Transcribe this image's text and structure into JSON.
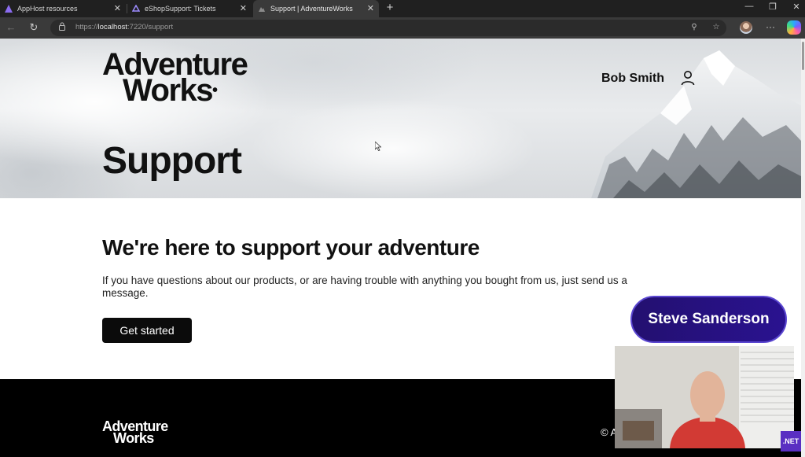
{
  "browser": {
    "tabs": [
      {
        "title": "AppHost resources",
        "active": false
      },
      {
        "title": "eShopSupport: Tickets",
        "active": false
      },
      {
        "title": "Support | AdventureWorks",
        "active": true
      }
    ],
    "url_prefix": "https://",
    "url_host": "localhost",
    "url_rest": ":7220/support",
    "icons": [
      "back-icon",
      "refresh-icon",
      "lock-icon",
      "zoom-icon",
      "favorite-star-icon",
      "more-icon"
    ]
  },
  "site": {
    "logo_line1": "Adventure",
    "logo_line2": "Works",
    "user_name": "Bob Smith",
    "hero_title": "Support"
  },
  "content": {
    "headline": "We're here to support your adventure",
    "paragraph": "If you have questions about our products, or are having trouble with anything you bought from us, just send us a message.",
    "cta_label": "Get started"
  },
  "footer": {
    "logo_line1": "Adventure",
    "logo_line2": "Works",
    "copyright": "© A"
  },
  "overlay": {
    "presenter_name": "Steve Sanderson",
    "badge": ".NET"
  },
  "colors": {
    "presenter_bg": "#2a1290",
    "footer_bg": "#000000",
    "button_bg": "#0b0b0b"
  }
}
